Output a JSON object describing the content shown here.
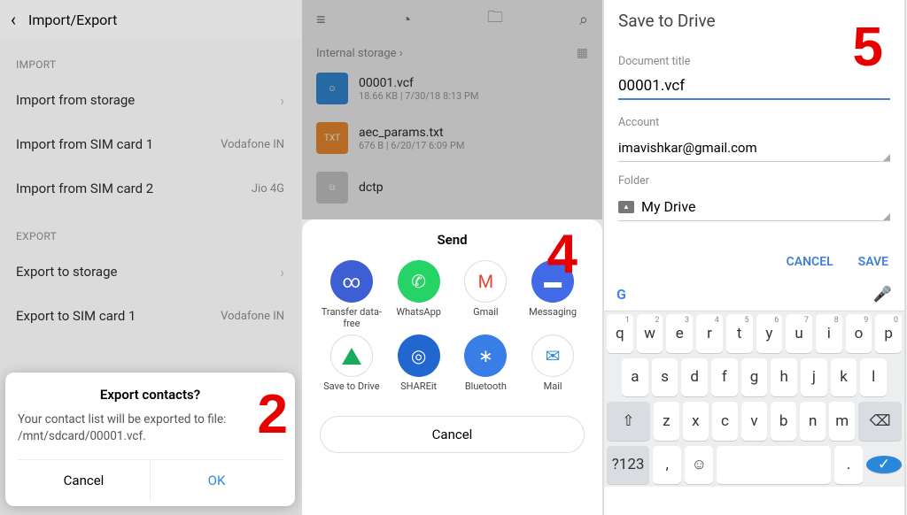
{
  "panel1": {
    "title": "Import/Export",
    "sections": {
      "import": {
        "label": "IMPORT",
        "items": [
          {
            "label": "Import from storage",
            "meta": "›"
          },
          {
            "label": "Import from SIM card 1",
            "meta": "Vodafone IN"
          },
          {
            "label": "Import from SIM card 2",
            "meta": "Jio 4G"
          }
        ]
      },
      "export": {
        "label": "EXPORT",
        "items": [
          {
            "label": "Export to storage",
            "meta": "›"
          },
          {
            "label": "Export to SIM card 1",
            "meta": "Vodafone IN"
          }
        ]
      }
    },
    "dialog": {
      "title": "Export contacts?",
      "msg": "Your contact list will be exported to file: /mnt/sdcard/00001.vcf.",
      "cancel": "Cancel",
      "ok": "OK"
    },
    "num": "2"
  },
  "panel2": {
    "breadcrumb": "Internal storage  ›",
    "files": [
      {
        "name": "00001.vcf",
        "meta": "18.66 KB  |  7/30/18 8:13 PM",
        "thumb": "vcf",
        "glyph": "☺"
      },
      {
        "name": "aec_params.txt",
        "meta": "676 B  |  6/20/17 6:09 PM",
        "thumb": "txt",
        "glyph": "TXT"
      },
      {
        "name": "dctp",
        "meta": "",
        "thumb": "gray",
        "glyph": "⧉"
      }
    ],
    "sheet": {
      "title": "Send",
      "items": [
        {
          "label": "Transfer data-free",
          "glyph": "∞"
        },
        {
          "label": "WhatsApp",
          "glyph": "✆"
        },
        {
          "label": "Gmail",
          "glyph": "M"
        },
        {
          "label": "Messaging",
          "glyph": "▬"
        },
        {
          "label": "Save to Drive",
          "glyph": ""
        },
        {
          "label": "SHAREit",
          "glyph": "◎"
        },
        {
          "label": "Bluetooth",
          "glyph": "∗"
        },
        {
          "label": "Mail",
          "glyph": "✉"
        }
      ],
      "cancel": "Cancel"
    },
    "num": "4"
  },
  "panel3": {
    "title": "Save to Drive",
    "doctitle_label": "Document title",
    "doctitle_value": "00001.vcf",
    "account_label": "Account",
    "account_value": "imavishkar@gmail.com",
    "folder_label": "Folder",
    "folder_value": "My Drive",
    "cancel": "CANCEL",
    "save": "SAVE",
    "num": "5",
    "keyboard": {
      "r1": [
        [
          "q",
          "1"
        ],
        [
          "w",
          "2"
        ],
        [
          "e",
          "3"
        ],
        [
          "r",
          "4"
        ],
        [
          "t",
          "5"
        ],
        [
          "y",
          "6"
        ],
        [
          "u",
          "7"
        ],
        [
          "i",
          "8"
        ],
        [
          "o",
          "9"
        ],
        [
          "p",
          "0"
        ]
      ],
      "r2": [
        "a",
        "s",
        "d",
        "f",
        "g",
        "h",
        "j",
        "k",
        "l"
      ],
      "r3": [
        "z",
        "x",
        "c",
        "v",
        "b",
        "n",
        "m"
      ],
      "sym": "?123",
      "comma": ",",
      "emoji": "☺",
      "period": "."
    }
  }
}
